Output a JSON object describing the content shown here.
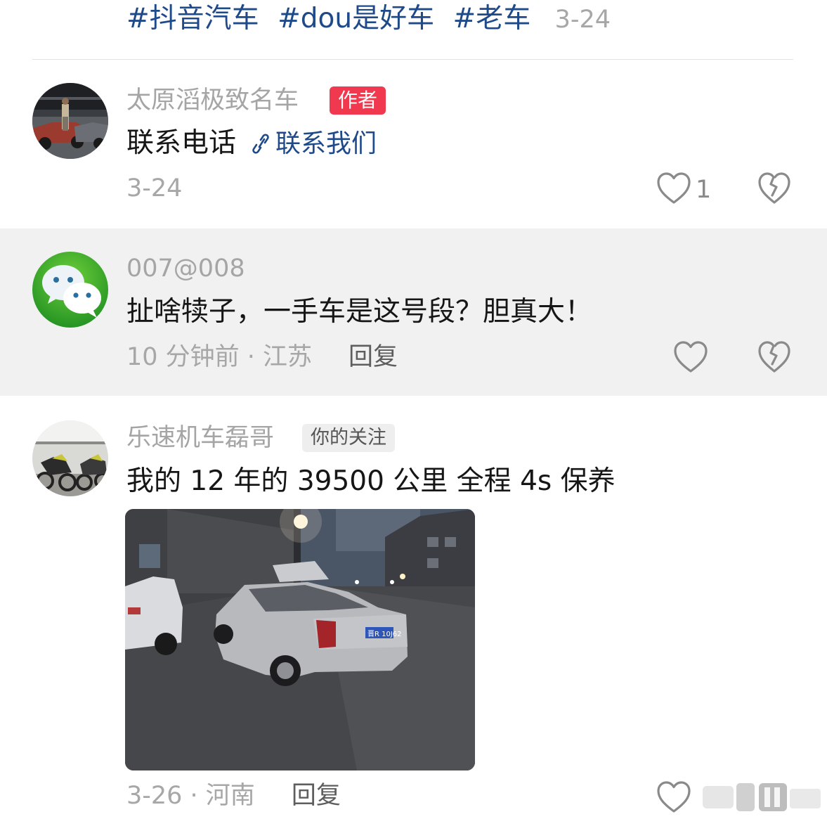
{
  "header": {
    "tags": [
      "#抖音汽车",
      "#dou是好车",
      "#老车"
    ],
    "date": "3-24"
  },
  "comments": [
    {
      "username": "太原滔极致名车",
      "badge": "作者",
      "text": "联系电话",
      "link_label": "联系我们",
      "meta": "3-24",
      "likes": "1"
    },
    {
      "username": "007@008",
      "text": "扯啥犊子，一手车是这号段？胆真大！",
      "meta": "10 分钟前 · 江苏",
      "reply_label": "回复"
    },
    {
      "username": "乐速机车磊哥",
      "badge": "你的关注",
      "text": "我的 12 年的 39500 公里 全程 4s 保养",
      "meta": "3-26 · 河南",
      "reply_label": "回复",
      "photo_plate": "晋R 10J62"
    }
  ],
  "colors": {
    "tag_blue": "#1f4a8a",
    "author_badge": "#f0384e",
    "muted_text": "#a7a7a7",
    "highlight_bg": "#f1f1f1"
  }
}
